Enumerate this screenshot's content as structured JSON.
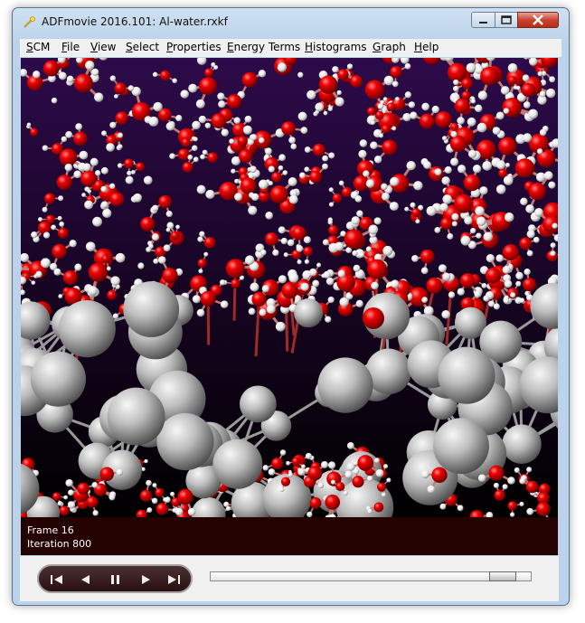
{
  "window": {
    "title": "ADFmovie 2016.101: Al-water.rxkf",
    "icon": "adf-wand-icon"
  },
  "menu": {
    "items": [
      "SCM",
      "File",
      "View",
      "Select",
      "Properties",
      "Energy Terms",
      "Histograms",
      "Graph",
      "Help"
    ]
  },
  "viewport": {
    "background_top": "#2d0a4a",
    "background_bottom": "#000000",
    "oxygen_color": "#e00000",
    "hydrogen_color": "#ffffff",
    "aluminum_color": "#b5b5b5"
  },
  "status": {
    "frame": "Frame 16",
    "iteration": "Iteration 800"
  },
  "playback": {
    "first": "first-frame-icon",
    "prev": "previous-icon",
    "pause": "pause-icon",
    "next": "next-icon",
    "last": "last-frame-icon",
    "progress": 0.95
  }
}
